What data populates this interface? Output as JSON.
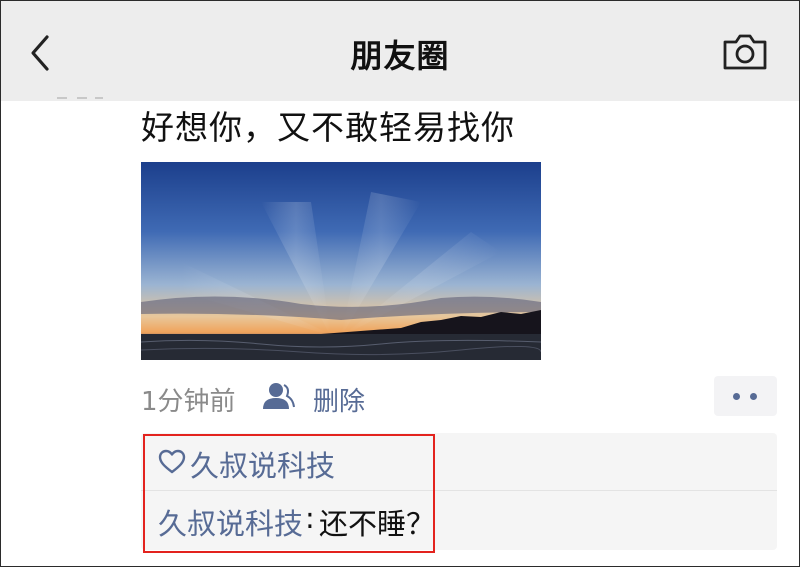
{
  "header": {
    "title": "朋友圈",
    "back_icon": "chevron-left-icon",
    "camera_icon": "camera-icon"
  },
  "post": {
    "text": "好想你，又不敢轻易找你",
    "image": "sunset-over-sea-photo",
    "time": "1分钟前",
    "visibility_icon": "person-icon",
    "delete_label": "删除",
    "more_icon": "more-dots-icon"
  },
  "likes": {
    "icon": "heart-icon",
    "names": "久叔说科技"
  },
  "comments": [
    {
      "author": "久叔说科技",
      "separator": ":",
      "text": " 还不睡？"
    }
  ],
  "colors": {
    "header_bg": "#ededed",
    "link": "#576b95",
    "highlight": "#e3231e"
  }
}
